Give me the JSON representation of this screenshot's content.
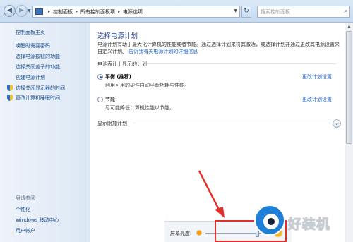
{
  "address_bar": {
    "crumbs": [
      "控制面板",
      "所有控制面板项",
      "电源选项"
    ],
    "search_placeholder": "搜索控制面板"
  },
  "left_pane": {
    "home": "控制面板主页",
    "items": [
      "唤醒时需要密码",
      "选择电源按钮的功能",
      "选择关闭盖子的功能",
      "创建电源计划",
      "选择关闭显示器的时间",
      "更改计算机睡眠时间"
    ],
    "see_also": "另请参阅",
    "bottom_items": [
      "个性化",
      "Windows 移动中心",
      "用户帐户"
    ]
  },
  "main": {
    "title": "选择电源计划",
    "description": "电源计划有助于最大化计算机的性能或者节能。通过选择计划来将其激活，或选择计划并通过更改其电源设置来自定义计划。",
    "description_link": "告诉我有关电源计划的详细信息",
    "section_header": "电池表计上显示的计划",
    "plans": [
      {
        "name": "平衡 (推荐)",
        "desc": "利用可用的硬件自动平衡功耗与性能。",
        "selected": true,
        "link": "更改计划设置"
      },
      {
        "name": "节能",
        "desc": "尽可能降低计算机性能以节能。",
        "selected": false,
        "link": "更改计划设置"
      }
    ],
    "more_plans": "显示附加计划"
  },
  "bottom": {
    "brightness_label": "屏幕亮度:",
    "brightness_level": 0.82
  },
  "watermark": {
    "text": "好装机"
  },
  "colors": {
    "accent_link": "#1a5ec4",
    "annotation_red": "#e0302a"
  }
}
